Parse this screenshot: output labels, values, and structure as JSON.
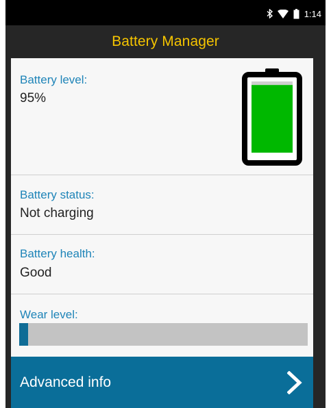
{
  "status_bar": {
    "time": "1:14",
    "icons": [
      "bluetooth-icon",
      "wifi-icon",
      "battery-icon"
    ]
  },
  "app": {
    "title": "Battery Manager"
  },
  "battery_level": {
    "label": "Battery level:",
    "value": "95%",
    "level_fraction": 0.95,
    "fill_color": "#00b800"
  },
  "battery_status": {
    "label": "Battery status:",
    "value": "Not charging"
  },
  "battery_health": {
    "label": "Battery health:",
    "value": "Good"
  },
  "wear_level": {
    "label": "Wear level:",
    "fraction": 0.03,
    "fill_color": "#0f6c96"
  },
  "advanced": {
    "label": "Advanced info",
    "icon": "chevron-right-icon"
  },
  "colors": {
    "accent": "#1e84b8",
    "title": "#f5c400",
    "button": "#0a6e99"
  }
}
